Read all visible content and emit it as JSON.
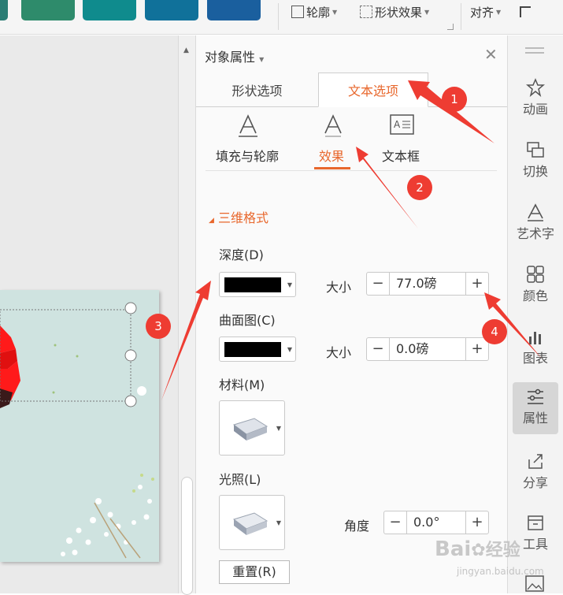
{
  "toolbar": {
    "outline_label": "轮廓",
    "shape_effect_label": "形状效果",
    "align_label": "对齐",
    "swatch_colors": [
      "#1a8a82",
      "#2e8b57",
      "#0f8b8d",
      "#10719a",
      "#1a5f9e"
    ]
  },
  "panel": {
    "title": "对象属性",
    "tabs": [
      "形状选项",
      "文本选项"
    ],
    "subtabs": [
      "填充与轮廓",
      "效果",
      "文本框"
    ],
    "section_title": "三维格式",
    "depth_label": "深度(D)",
    "contour_label": "曲面图(C)",
    "size_label": "大小",
    "depth_size_value": "77.0磅",
    "contour_size_value": "0.0磅",
    "material_label": "材料(M)",
    "lighting_label": "光照(L)",
    "angle_label": "角度",
    "angle_value": "0.0°",
    "reset_label": "重置(R)",
    "accent_color": "#e8672c"
  },
  "sidebar": {
    "items": [
      "动画",
      "切换",
      "艺术字",
      "颜色",
      "图表",
      "属性",
      "分享",
      "工具"
    ]
  },
  "annotations": {
    "badges": [
      "1",
      "2",
      "3",
      "4"
    ],
    "color": "#ee3c32"
  },
  "watermark": {
    "brand": "Bai",
    "brand2": "经验",
    "url": "jingyan.baidu.com"
  }
}
